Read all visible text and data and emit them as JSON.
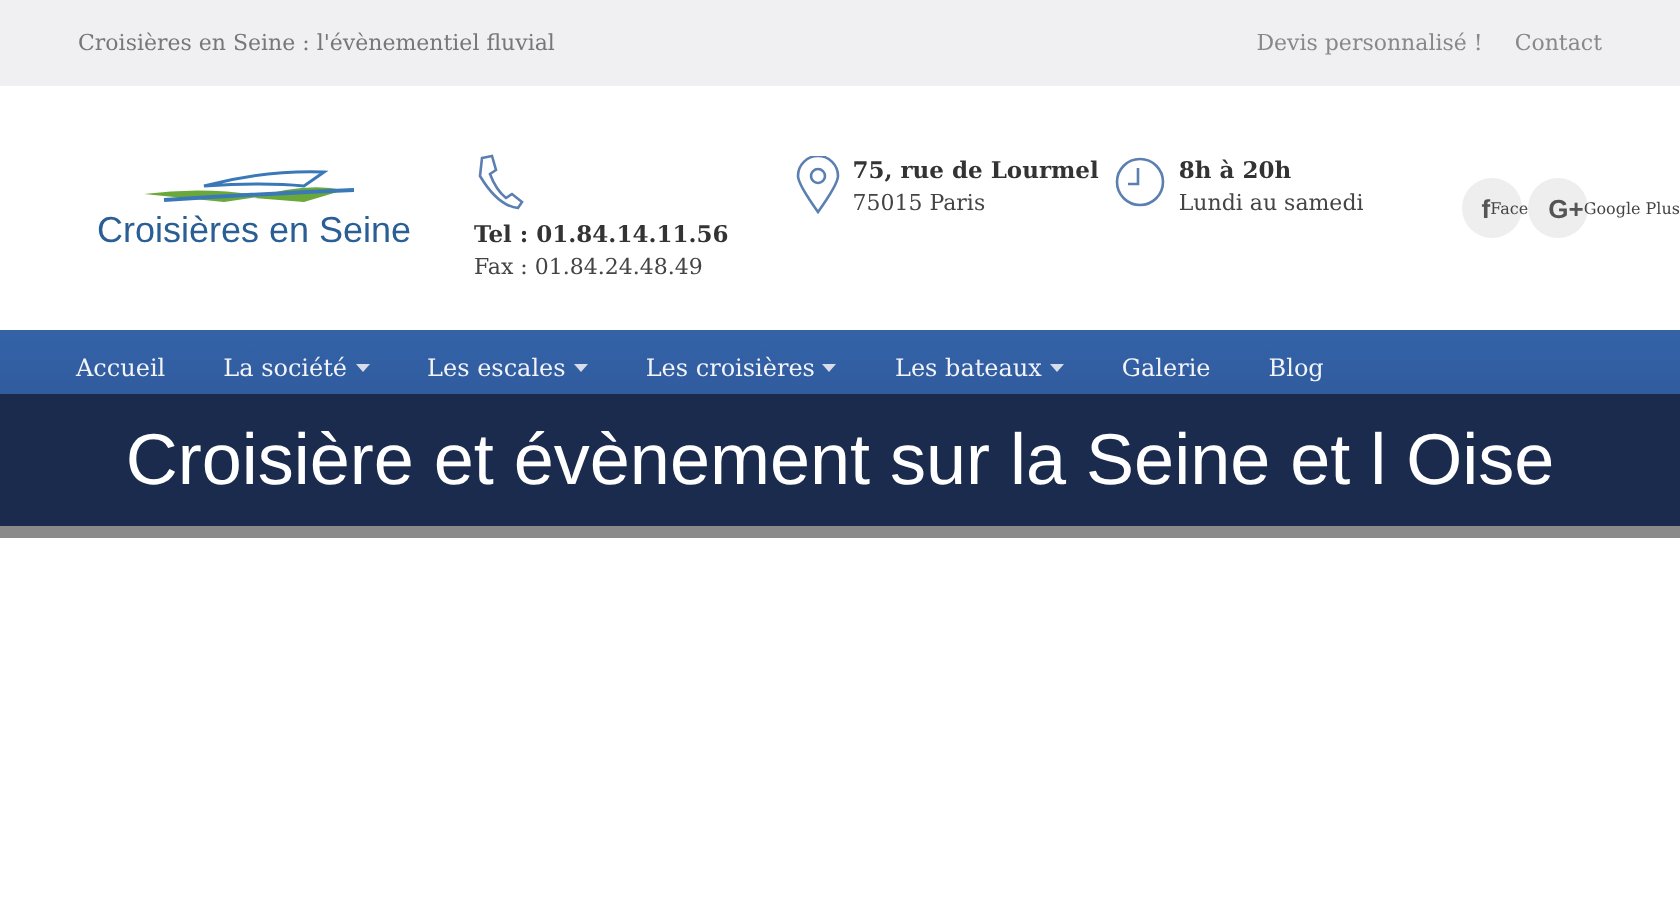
{
  "topbar": {
    "tagline": "Croisières en Seine : l'évènementiel fluvial",
    "links": [
      "Devis personnalisé !",
      "Contact"
    ]
  },
  "header": {
    "logo_text": "Croisières en Seine",
    "contacts": [
      {
        "kind": "phone",
        "line1": "Tel : 01.84.14.11.56",
        "line2": "Fax : 01.84.24.48.49"
      },
      {
        "kind": "address",
        "line1": "75, rue de Lourmel",
        "line2": "75015 Paris"
      },
      {
        "kind": "hours",
        "line1": "8h à 20h",
        "line2": "Lundi au samedi"
      }
    ],
    "social": [
      {
        "glyph": "f",
        "label": "Face"
      },
      {
        "glyph": "G+",
        "label": "Google Plus"
      }
    ]
  },
  "nav": {
    "items": [
      {
        "label": "Accueil",
        "dropdown": false
      },
      {
        "label": "La société",
        "dropdown": true
      },
      {
        "label": "Les escales",
        "dropdown": true
      },
      {
        "label": "Les croisières",
        "dropdown": true
      },
      {
        "label": "Les bateaux",
        "dropdown": true
      },
      {
        "label": "Galerie",
        "dropdown": false
      },
      {
        "label": "Blog",
        "dropdown": false
      }
    ]
  },
  "overlay_title": "Croisière et évènement sur la Seine et l Oise"
}
